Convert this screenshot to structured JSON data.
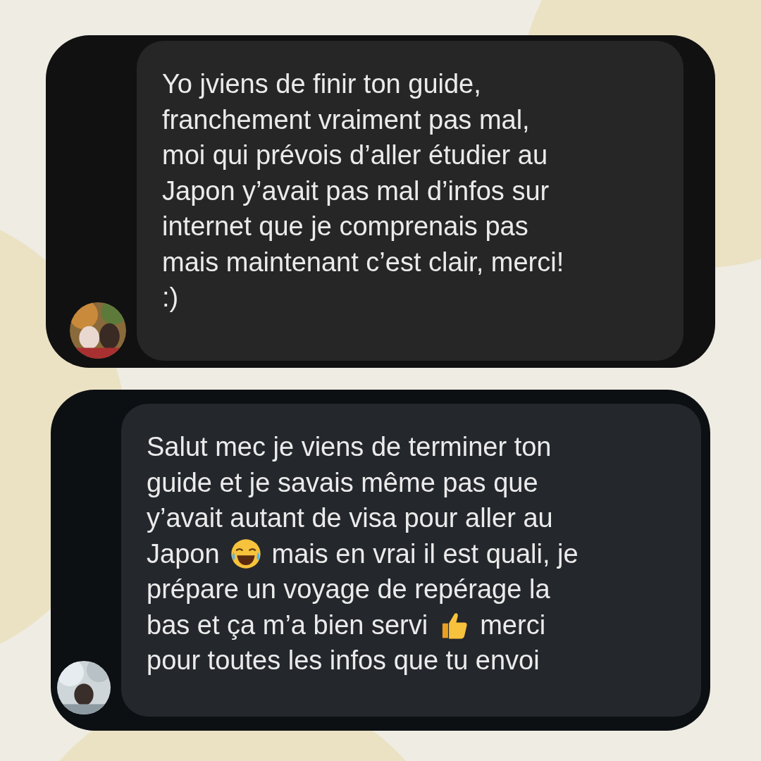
{
  "messages": [
    {
      "lines": [
        [
          {
            "kind": "text",
            "text": "Yo jviens de finir ton guide,"
          }
        ],
        [
          {
            "kind": "text",
            "text": "franchement vraiment pas mal,"
          }
        ],
        [
          {
            "kind": "text",
            "text": "moi qui prévois d’aller étudier au"
          }
        ],
        [
          {
            "kind": "text",
            "text": "Japon y’avait pas mal d’infos sur"
          }
        ],
        [
          {
            "kind": "text",
            "text": "internet que je comprenais pas"
          }
        ],
        [
          {
            "kind": "text",
            "text": "mais maintenant c’est clair, merci!"
          }
        ],
        [
          {
            "kind": "text",
            "text": ":)"
          }
        ]
      ]
    },
    {
      "lines": [
        [
          {
            "kind": "text",
            "text": "Salut mec je viens de terminer ton"
          }
        ],
        [
          {
            "kind": "text",
            "text": "guide et je savais même pas que"
          }
        ],
        [
          {
            "kind": "text",
            "text": "y’avait autant de visa pour aller au"
          }
        ],
        [
          {
            "kind": "text",
            "text": "Japon"
          },
          {
            "kind": "laughing"
          },
          {
            "kind": "text",
            "text": "mais en vrai il est quali, je"
          }
        ],
        [
          {
            "kind": "text",
            "text": "prépare un voyage de repérage la"
          }
        ],
        [
          {
            "kind": "text",
            "text": "bas et ça m’a bien servi"
          },
          {
            "kind": "thumbs"
          },
          {
            "kind": "text",
            "text": "merci"
          }
        ],
        [
          {
            "kind": "text",
            "text": "pour toutes les infos que tu envoi"
          }
        ]
      ]
    }
  ]
}
